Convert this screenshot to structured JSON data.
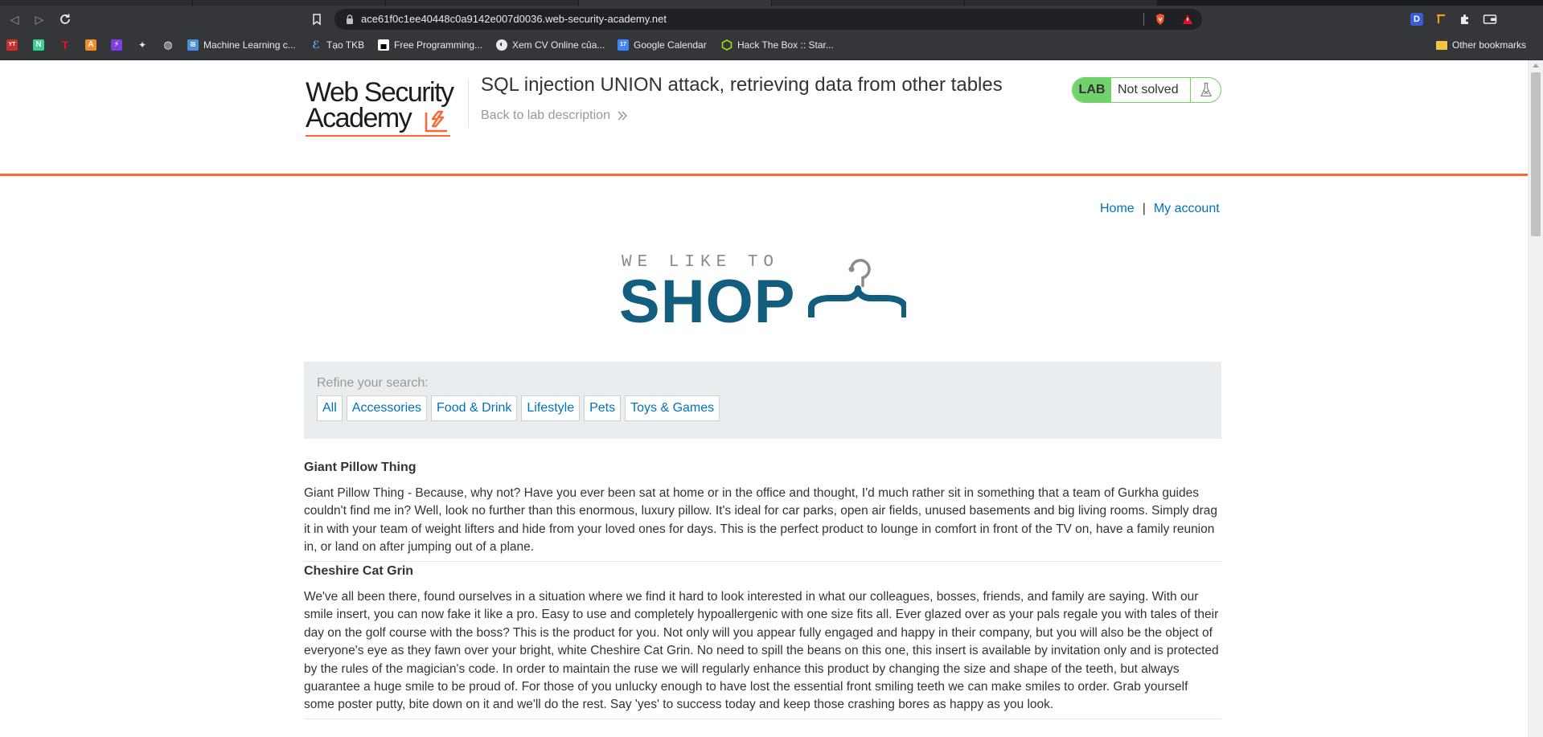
{
  "browser": {
    "url": "ace61f0c1ee40448c0a9142e007d0036.web-security-academy.net",
    "bookmarks": [
      {
        "label": "Machine Learning c...",
        "icon": "ml-icon"
      },
      {
        "label": "Tạo TKB",
        "icon": "tkb-icon"
      },
      {
        "label": "Free Programming...",
        "icon": "programming-icon"
      },
      {
        "label": "Xem CV Online của...",
        "icon": "globe-icon"
      },
      {
        "label": "Google Calendar",
        "icon": "calendar-icon"
      },
      {
        "label": "Hack The Box :: Star...",
        "icon": "htb-icon"
      }
    ],
    "other_bookmarks": "Other bookmarks",
    "calendar_day": "17",
    "extension_badge": "D"
  },
  "academy": {
    "logo_line1": "Web Security",
    "logo_line2": "Academy",
    "lab_title": "SQL injection UNION attack, retrieving data from other tables",
    "back_link": "Back to lab description",
    "lab_badge": "LAB",
    "lab_status": "Not solved"
  },
  "nav": {
    "home": "Home",
    "separator": "|",
    "account": "My account"
  },
  "shop_logo": {
    "tagline": "WE LIKE TO",
    "word": "SHOP"
  },
  "filter": {
    "label": "Refine your search:",
    "categories": [
      "All",
      "Accessories",
      "Food & Drink",
      "Lifestyle",
      "Pets",
      "Toys & Games"
    ]
  },
  "products": [
    {
      "name": "Giant Pillow Thing",
      "description": "Giant Pillow Thing - Because, why not? Have you ever been sat at home or in the office and thought, I'd much rather sit in something that a team of Gurkha guides couldn't find me in? Well, look no further than this enormous, luxury pillow. It's ideal for car parks, open air fields, unused basements and big living rooms. Simply drag it in with your team of weight lifters and hide from your loved ones for days. This is the perfect product to lounge in comfort in front of the TV on, have a family reunion in, or land on after jumping out of a plane."
    },
    {
      "name": "Cheshire Cat Grin",
      "description": "We've all been there, found ourselves in a situation where we find it hard to look interested in what our colleagues, bosses, friends, and family are saying. With our smile insert, you can now fake it like a pro. Easy to use and completely hypoallergenic with one size fits all. Ever glazed over as your pals regale you with tales of their day on the golf course with the boss? This is the product for you. Not only will you appear fully engaged and happy in their company, but you will also be the object of everyone's eye as they fawn over your bright, white Cheshire Cat Grin. No need to spill the beans on this one, this insert is available by invitation only and is protected by the rules of the magician's code. In order to maintain the ruse we will regularly enhance this product by changing the size and shape of the teeth, but always guarantee a huge smile to be proud of. For those of you unlucky enough to have lost the essential front smiling teeth we can make smiles to order. Grab yourself some poster putty, bite down on it and we'll do the rest. Say 'yes' to success today and keep those crashing bores as happy as you look."
    }
  ],
  "colors": {
    "accent_orange": "#ff6633",
    "link_blue": "#0071bc",
    "lab_green": "#70d16d",
    "shop_teal": "#135d7e"
  }
}
